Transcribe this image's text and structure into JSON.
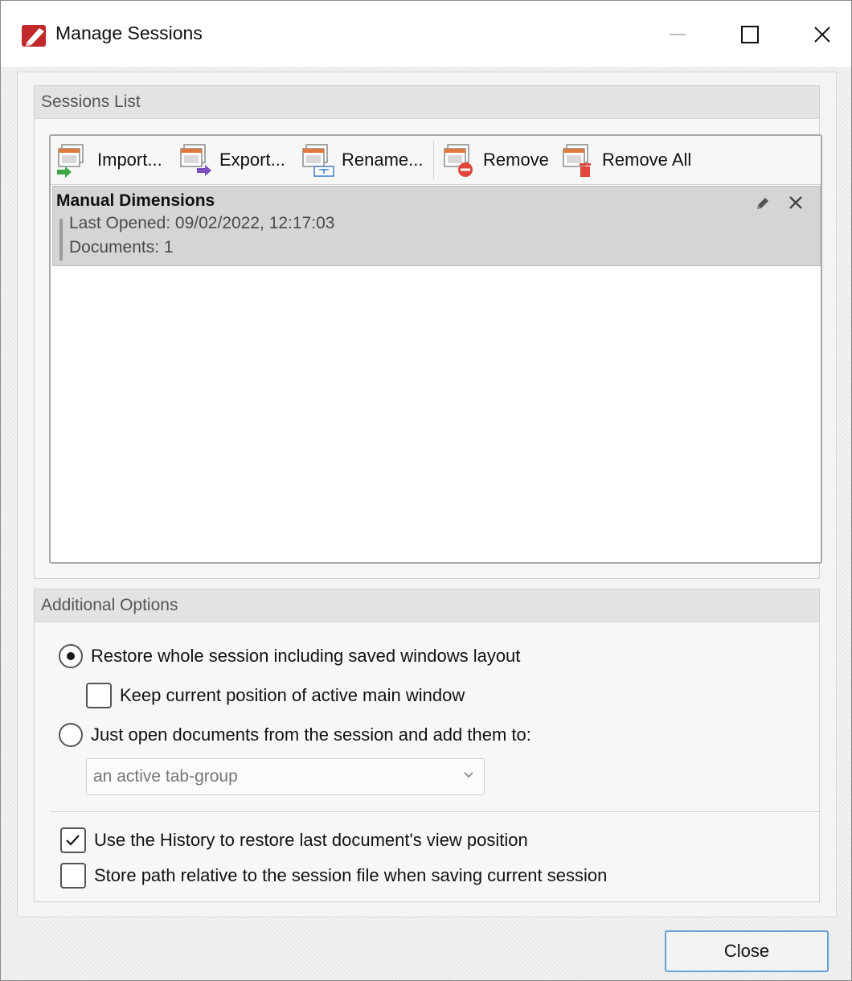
{
  "window": {
    "title": "Manage Sessions",
    "controls": [
      "minimize-icon",
      "maximize-icon",
      "close-icon"
    ]
  },
  "sessions_group": {
    "header": "Sessions List",
    "toolbar": {
      "import_label": "Import...",
      "export_label": "Export...",
      "rename_label": "Rename...",
      "remove_label": "Remove",
      "remove_all_label": "Remove All"
    },
    "items": [
      {
        "name": "Manual Dimensions",
        "last_opened": "Last Opened: 09/02/2022, 12:17:03",
        "documents": "Documents: 1"
      }
    ]
  },
  "options_group": {
    "header": "Additional Options",
    "restore_whole_label": "Restore whole session including saved windows layout",
    "restore_whole_selected": true,
    "keep_position_label": "Keep current position of active main window",
    "keep_position_checked": false,
    "just_open_label": "Just open documents from the session and add them to:",
    "just_open_selected": false,
    "add_target_value": "an active tab-group",
    "use_history_label": "Use the History to restore last document's view position",
    "use_history_checked": true,
    "store_relative_label": "Store path relative to the session file when saving current session",
    "store_relative_checked": false
  },
  "footer": {
    "close_label": "Close"
  },
  "colors": {
    "accent": "#6aa0d8",
    "selected_row": "#d5d5d5",
    "app_icon": "#c0282a"
  }
}
